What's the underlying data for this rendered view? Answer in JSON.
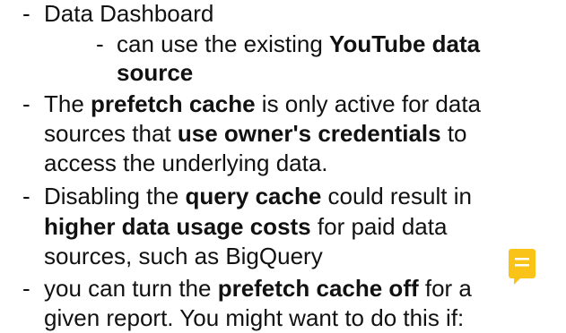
{
  "notes": {
    "items": [
      {
        "dash": "-",
        "lines": [
          [
            {
              "t": "Data Dashboard",
              "b": false
            }
          ]
        ]
      },
      {
        "dash": "-",
        "lines": [
          [
            {
              "t": "can use the existing ",
              "b": false
            },
            {
              "t": "YouTube data",
              "b": true
            }
          ],
          [
            {
              "t": "source",
              "b": true
            }
          ]
        ]
      },
      {
        "dash": "-",
        "lines": [
          [
            {
              "t": "The ",
              "b": false
            },
            {
              "t": "prefetch cache",
              "b": true
            },
            {
              "t": " is only active for data",
              "b": false
            }
          ],
          [
            {
              "t": "sources that ",
              "b": false
            },
            {
              "t": "use owner's credentials",
              "b": true
            },
            {
              "t": " to",
              "b": false
            }
          ],
          [
            {
              "t": "access the underlying data.",
              "b": false
            }
          ]
        ]
      },
      {
        "dash": "-",
        "lines": [
          [
            {
              "t": "Disabling the ",
              "b": false
            },
            {
              "t": "query cache",
              "b": true
            },
            {
              "t": " could result in",
              "b": false
            }
          ],
          [
            {
              "t": "higher data usage costs",
              "b": true
            },
            {
              "t": " for paid data",
              "b": false
            }
          ],
          [
            {
              "t": "sources, such as BigQuery",
              "b": false
            }
          ]
        ]
      },
      {
        "dash": "-",
        "lines": [
          [
            {
              "t": "you can turn the ",
              "b": false
            },
            {
              "t": "prefetch cache off",
              "b": true
            },
            {
              "t": " for a",
              "b": false
            }
          ],
          [
            {
              "t": "given report. You might want to do this if:",
              "b": false
            }
          ]
        ]
      }
    ]
  },
  "comment_icon": {
    "name": "comment-icon",
    "color": "#F9C417",
    "line_color": "#ffffff"
  }
}
